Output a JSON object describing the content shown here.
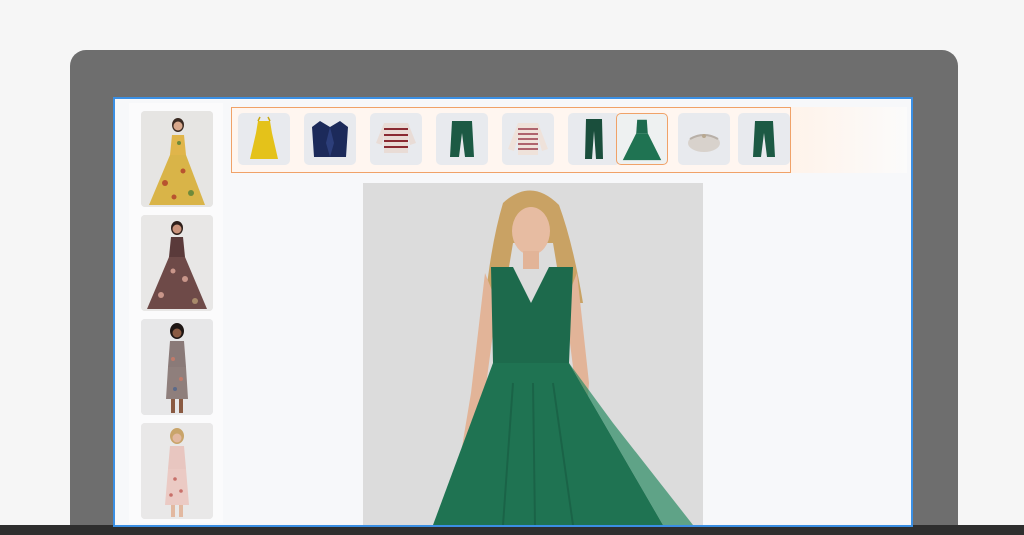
{
  "colors": {
    "accent_border": "#f0a268",
    "screen_border": "#3b8fe3",
    "selected_dress": "#1e6b4e"
  },
  "side_gallery": [
    {
      "icon": "model-yellow-floral-dress-icon"
    },
    {
      "icon": "model-brown-floral-dress-icon"
    },
    {
      "icon": "model-floral-midi-dress-icon"
    },
    {
      "icon": "model-pink-floral-dress-icon"
    }
  ],
  "outfit_strip": [
    {
      "icon": "yellow-dress-icon",
      "selected": false
    },
    {
      "icon": "navy-blazer-icon",
      "selected": false
    },
    {
      "icon": "striped-top-icon",
      "selected": false
    },
    {
      "icon": "green-pants-icon",
      "selected": false
    },
    {
      "icon": "striped-sweater-icon",
      "selected": false
    },
    {
      "icon": "green-trousers-icon",
      "selected": false
    },
    {
      "icon": "green-gown-icon",
      "selected": true
    },
    {
      "icon": "silver-clutch-icon",
      "selected": false
    },
    {
      "icon": "green-pants-icon",
      "selected": false
    }
  ],
  "preview": {
    "icon": "model-green-gown-icon"
  }
}
